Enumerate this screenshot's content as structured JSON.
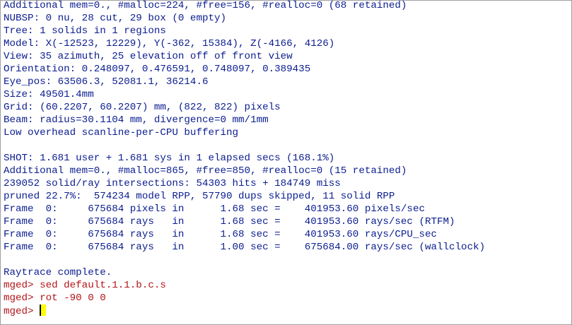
{
  "output_lines": [
    "Additional mem=0., #malloc=224, #free=156, #realloc=0 (68 retained)",
    "NUBSP: 0 nu, 28 cut, 29 box (0 empty)",
    "Tree: 1 solids in 1 regions",
    "Model: X(-12523, 12229), Y(-362, 15384), Z(-4166, 4126)",
    "View: 35 azimuth, 25 elevation off of front view",
    "Orientation: 0.248097, 0.476591, 0.748097, 0.389435",
    "Eye_pos: 63506.3, 52081.1, 36214.6",
    "Size: 49501.4mm",
    "Grid: (60.2207, 60.2207) mm, (822, 822) pixels",
    "Beam: radius=30.1104 mm, divergence=0 mm/1mm",
    "Low overhead scanline-per-CPU buffering",
    "",
    "SHOT: 1.681 user + 1.681 sys in 1 elapsed secs (168.1%)",
    "Additional mem=0., #malloc=865, #free=850, #realloc=0 (15 retained)",
    "239052 solid/ray intersections: 54303 hits + 184749 miss",
    "pruned 22.7%:  574234 model RPP, 57790 dups skipped, 11 solid RPP",
    "Frame  0:     675684 pixels in      1.68 sec =    401953.60 pixels/sec",
    "Frame  0:     675684 rays   in      1.68 sec =    401953.60 rays/sec (RTFM)",
    "Frame  0:     675684 rays   in      1.68 sec =    401953.60 rays/CPU_sec",
    "Frame  0:     675684 rays   in      1.00 sec =    675684.00 rays/sec (wallclock)",
    "",
    "Raytrace complete."
  ],
  "commands": [
    "mged> sed default.1.1.b.c.s",
    "mged> rot -90 0 0"
  ],
  "current_prompt": "mged> ",
  "colors": {
    "output_text": "#0b1d8f",
    "prompt_text": "#b3141a",
    "cursor": "#ffff00",
    "background": "#ffffff"
  }
}
